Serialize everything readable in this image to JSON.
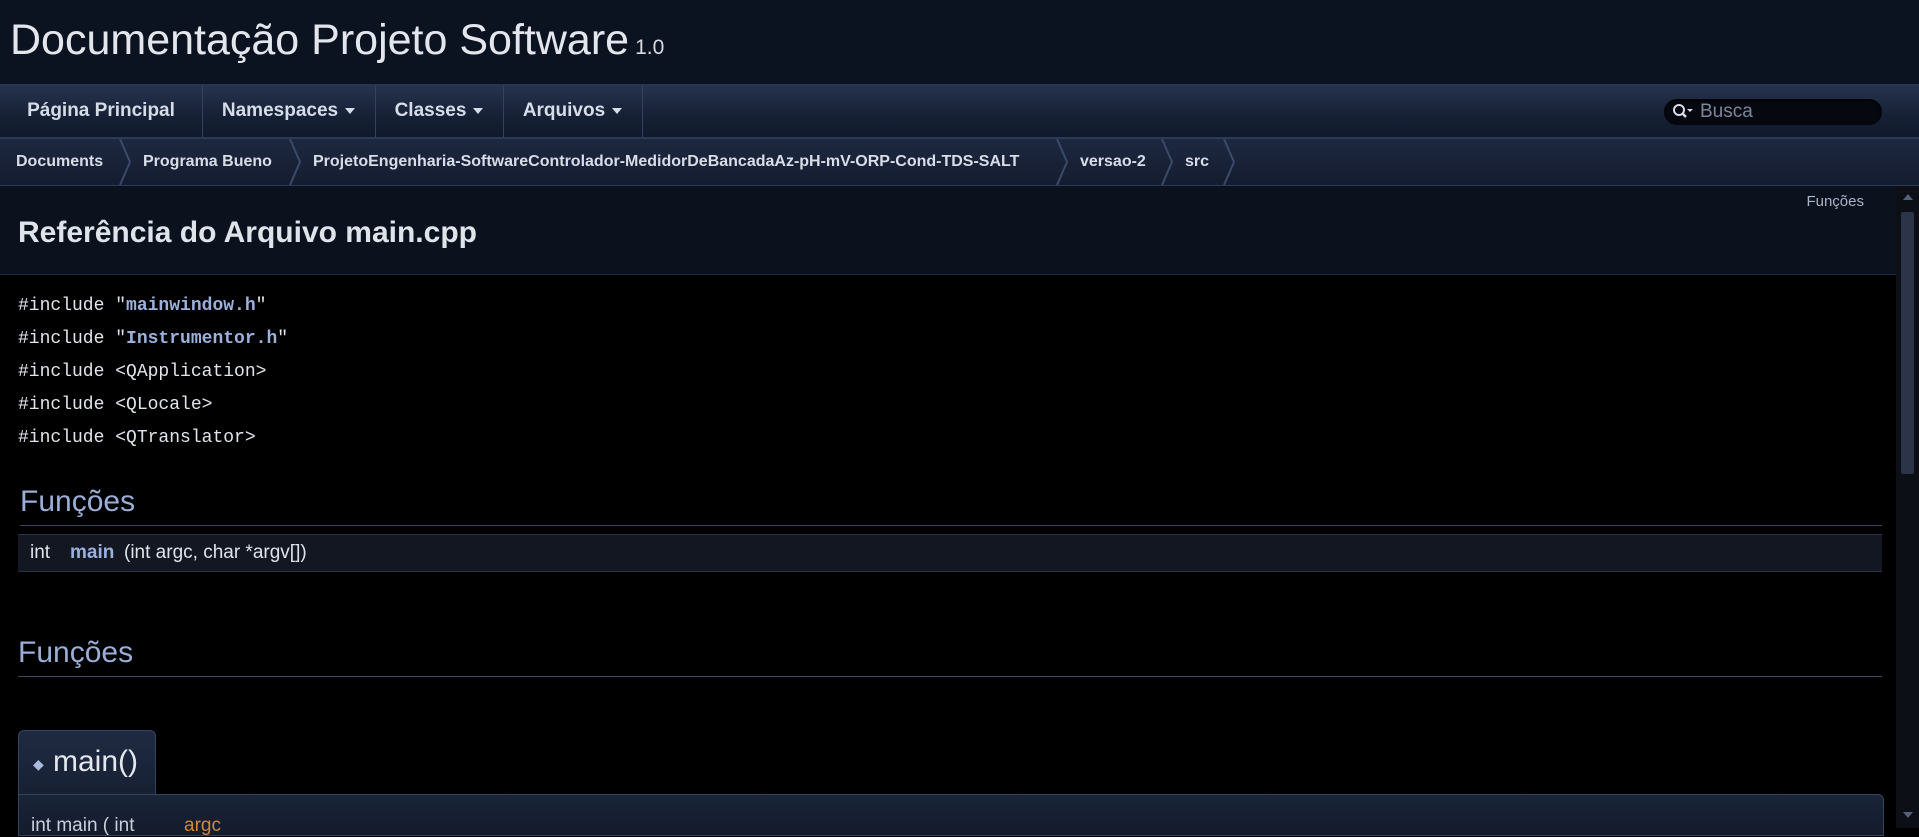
{
  "title": {
    "project_name": "Documentação Projeto Software",
    "project_number": "1.0"
  },
  "nav": {
    "items": [
      {
        "label": "Página Principal",
        "has_dropdown": false
      },
      {
        "label": "Namespaces",
        "has_dropdown": true
      },
      {
        "label": "Classes",
        "has_dropdown": true
      },
      {
        "label": "Arquivos",
        "has_dropdown": true
      }
    ],
    "search": {
      "placeholder": "Busca",
      "icon": "search-icon"
    }
  },
  "breadcrumb": [
    "Documents",
    "Programa Bueno",
    "ProjetoEngenharia-SoftwareControlador-MedidorDeBancadaAz-pH-mV-ORP-Cond-TDS-SALT",
    "versao-2",
    "src"
  ],
  "header": {
    "summary_link": "Funções",
    "page_title": "Referência do Arquivo main.cpp"
  },
  "includes": [
    {
      "prefix": "#include \"",
      "file": "mainwindow.h",
      "suffix": "\"",
      "linked": true
    },
    {
      "prefix": "#include \"",
      "file": "Instrumentor.h",
      "suffix": "\"",
      "linked": true
    },
    {
      "prefix": "#include <",
      "file": "QApplication",
      "suffix": ">",
      "linked": false
    },
    {
      "prefix": "#include <",
      "file": "QLocale",
      "suffix": ">",
      "linked": false
    },
    {
      "prefix": "#include <",
      "file": "QTranslator",
      "suffix": ">",
      "linked": false
    }
  ],
  "member_section": {
    "heading": "Funções",
    "member": {
      "type": "int",
      "name": "main",
      "args": "(int argc, char *argv[])"
    }
  },
  "details_section": {
    "heading": "Funções",
    "memtitle": "main()",
    "proto_text": "int main ( int",
    "proto_param": "argc"
  },
  "colors": {
    "background": "#000000",
    "link": "#9bb0dc",
    "heading": "#9aaed8",
    "param": "#d1873c"
  }
}
